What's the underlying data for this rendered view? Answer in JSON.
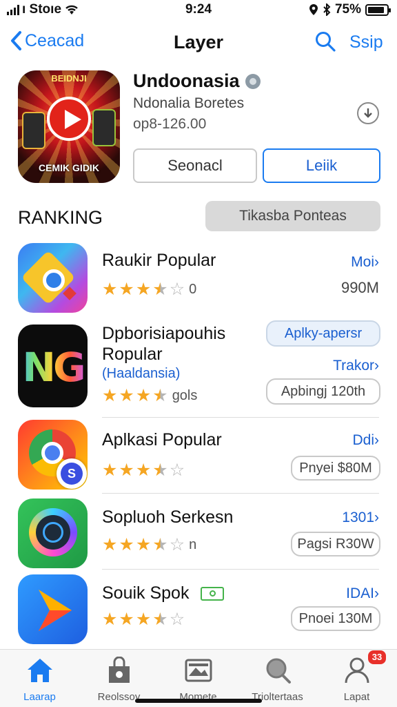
{
  "status": {
    "carrier": "ı Stoıe",
    "time": "9:24",
    "battery": "75%"
  },
  "nav": {
    "back_label": "Ceacad",
    "title": "Layer",
    "action_label": "Ssip"
  },
  "hero": {
    "name": "Undoonasia",
    "subtitle": "Ndonalia Boretes",
    "price": "op8-126.00",
    "icon_header": "BEIDNJI",
    "icon_brand": "CEMIK GIDIK",
    "secondary_button": "Seonacl",
    "primary_button": "Leiik"
  },
  "ranking": {
    "heading": "RANKING",
    "filter_label": "Tikasba Ponteas"
  },
  "apps": [
    {
      "name": "Raukir Popular",
      "rating": 3.5,
      "count": "0",
      "link": "Moi›",
      "size": "990M"
    },
    {
      "name_line1": "Dpborisiapouhis",
      "name_line2": "Ropular",
      "subtitle": "(Haaldansia)",
      "rating": 3.5,
      "count": "gols",
      "tag": "Aplky-apersr",
      "link": "Trakor›",
      "size": "Apbingj 120th",
      "icon_text": "NG"
    },
    {
      "name": "Aplkasi Popular",
      "rating": 3.5,
      "count": "",
      "link": "Ddi›",
      "size": "Pnyei $80M",
      "icon_badge": "S"
    },
    {
      "name": "Sopluoh Serkesn",
      "rating": 3.5,
      "count": "n",
      "link": "1301›",
      "size": "Pagsi R30W"
    },
    {
      "name": "Souik Spok",
      "rating": 3.5,
      "count": "",
      "link": "IDAI›",
      "size": "Pnoei 130M"
    }
  ],
  "tabs": [
    {
      "label": "Laarap",
      "icon": "home-icon",
      "active": true
    },
    {
      "label": "Reolssoy",
      "icon": "bag-icon",
      "active": false
    },
    {
      "label": "Momete",
      "icon": "media-icon",
      "active": false
    },
    {
      "label": "Trioltertaas",
      "icon": "search-icon",
      "active": false
    },
    {
      "label": "Lapat",
      "icon": "person-icon",
      "active": false
    }
  ],
  "notification_count": "33",
  "colors": {
    "accent": "#1a7bf0",
    "star": "#f5a623",
    "badge": "#e8302a"
  }
}
